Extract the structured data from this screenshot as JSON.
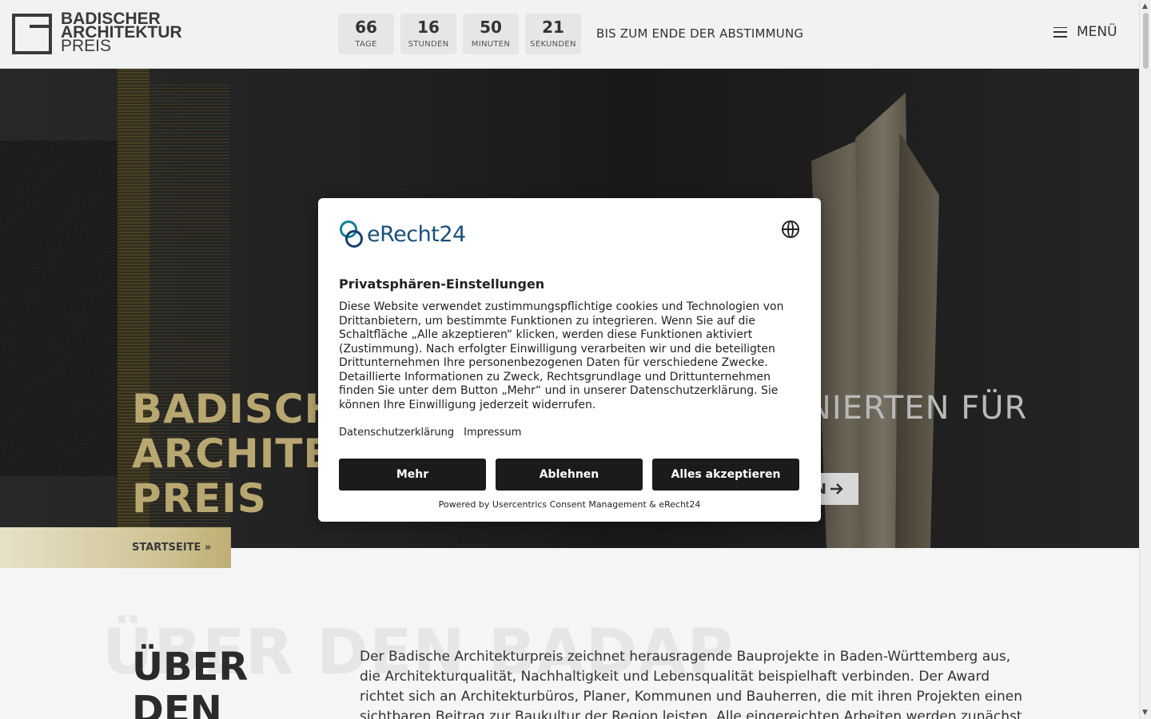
{
  "header": {
    "logo": {
      "line1": "BADISCHER",
      "line2": "ARCHITEKTUR",
      "line3": "PREIS"
    },
    "countdown": [
      {
        "value": "66",
        "label": "TAGE"
      },
      {
        "value": "16",
        "label": "STUNDEN"
      },
      {
        "value": "50",
        "label": "MINUTEN"
      },
      {
        "value": "21",
        "label": "SEKUNDEN"
      }
    ],
    "countdown_caption": "BIS ZUM ENDE DER ABSTIMMUNG",
    "menu_label": "MENÜ"
  },
  "hero": {
    "title_line1": "BADISCH",
    "title_line2": "ARCHITE",
    "title_line3": "PREIS",
    "subtitle": "NIERTEN FÜR",
    "cta_visible": "N",
    "breadcrumb": "STARTSEITE »"
  },
  "about": {
    "ghost_text": "ÜBER DEN BADAP",
    "title_line1": "ÜBER",
    "title_line2": "DEN",
    "text": "Der Badische Architekturpreis zeichnet herausragende Bauprojekte in Baden-Württemberg aus, die Architekturqualität, Nachhaltigkeit und Lebensqualität beispielhaft verbinden. Der Award richtet sich an Architekturbüros, Planer, Kommunen und Bauherren, die mit ihren Projekten einen sichtbaren Beitrag zur Baukultur der Region leisten. Alle eingereichten Arbeiten werden zunächst"
  },
  "consent": {
    "brand": "eRecht24",
    "title": "Privatsphären-Einstellungen",
    "body": "Diese Website verwendet zustimmungspflichtige cookies und Technologien von Drittanbietern, um bestimmte Funktionen zu integrieren. Wenn Sie auf die Schaltfläche „Alle akzeptieren“ klicken, werden diese Funktionen aktiviert (Zustimmung). Nach erfolgter Einwilligung verarbeiten wir und die beteiligten Drittunternehmen Ihre personenbezogenen Daten für verschiedene Zwecke. Detaillierte Informationen zu Zweck, Rechtsgrundlage und Drittunternehmen finden Sie unter dem Button „Mehr“ und in unserer Datenschutzerklärung. Sie können Ihre Einwilligung jederzeit widerrufen.",
    "link_privacy": "Datenschutzerklärung",
    "link_imprint": "Impressum",
    "btn_more": "Mehr",
    "btn_decline": "Ablehnen",
    "btn_accept": "Alles akzeptieren",
    "powered_by": "Powered by Usercentrics Consent Management & eRecht24"
  },
  "icons": {
    "menu": "hamburger-icon",
    "language": "globe-icon",
    "cta_arrow": "arrow-right-icon"
  },
  "colors": {
    "gold": "#b8a770",
    "button_dark": "#1b1b1b",
    "brand_blue": "#1a4f7a"
  }
}
